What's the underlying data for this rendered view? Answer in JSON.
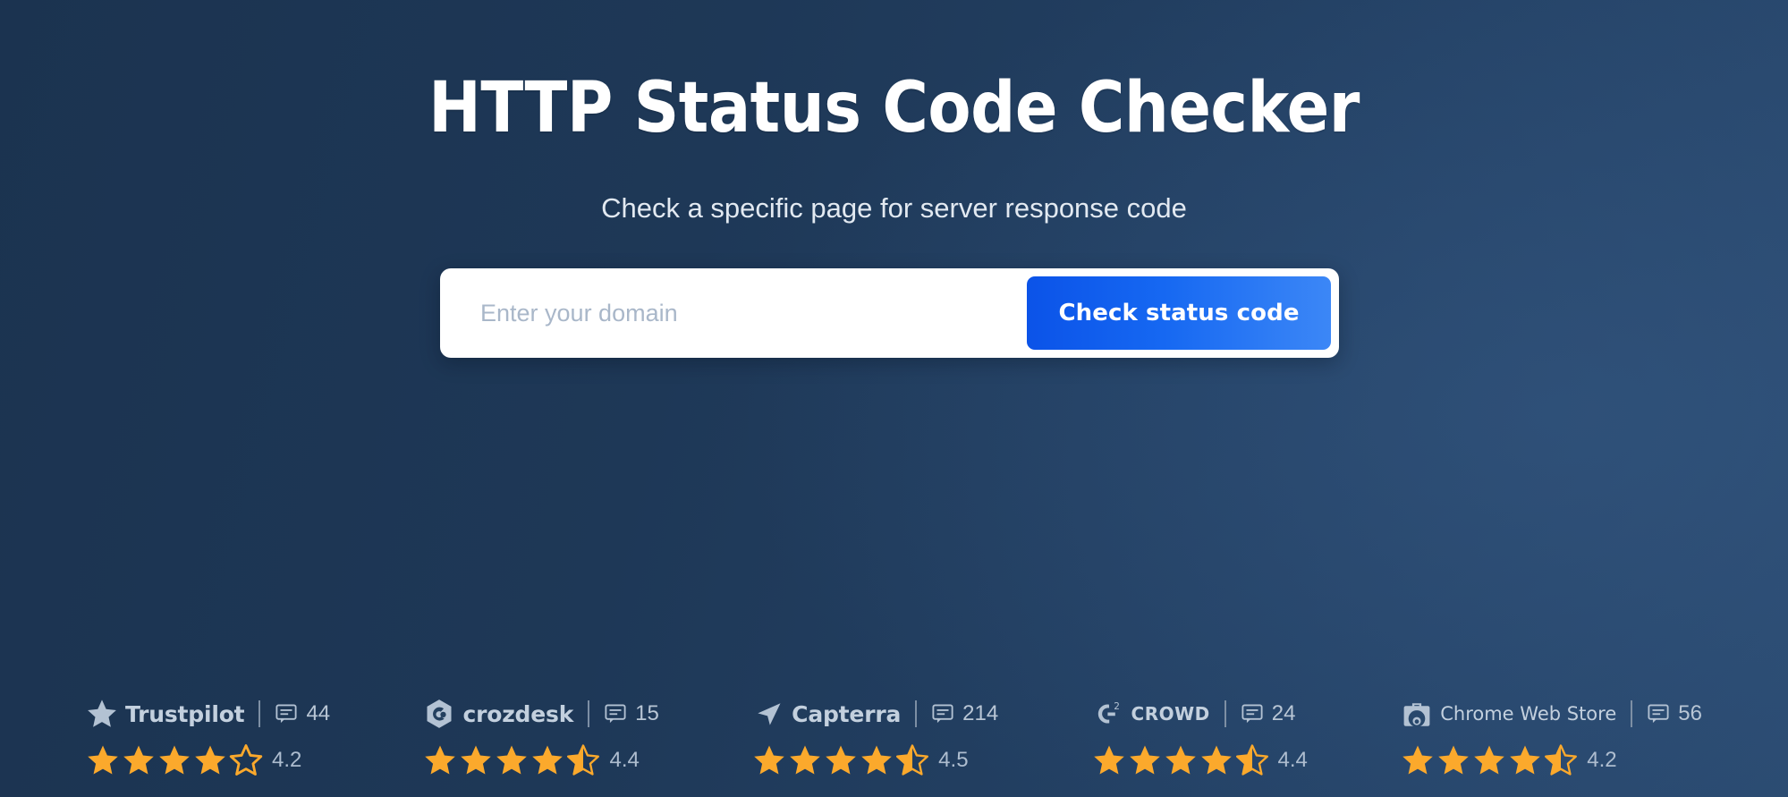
{
  "hero": {
    "title": "HTTP Status Code Checker",
    "subtitle": "Check a specific page for server response code"
  },
  "search": {
    "placeholder": "Enter your domain",
    "value": "",
    "button_label": "Check status code"
  },
  "colors": {
    "background_dark": "#1b3350",
    "background_light": "#2a4a70",
    "button_gradient_start": "#0b53e8",
    "button_gradient_end": "#3c87f6",
    "star_filled": "#fba92c",
    "brand_text": "#c3d0de",
    "card_background": "#ffffff"
  },
  "badges": [
    {
      "brand": "Trustpilot",
      "logo_icon": "trustpilot-star-icon",
      "review_icon": "comment-icon",
      "review_count": "44",
      "rating": "4.2",
      "stars_full": 4,
      "stars_half": 0,
      "stars_empty": 1
    },
    {
      "brand": "crozdesk",
      "logo_icon": "crozdesk-hexagon-icon",
      "review_icon": "comment-icon",
      "review_count": "15",
      "rating": "4.4",
      "stars_full": 4,
      "stars_half": 1,
      "stars_empty": 0
    },
    {
      "brand": "Capterra",
      "logo_icon": "capterra-arrow-icon",
      "review_icon": "comment-icon",
      "review_count": "214",
      "rating": "4.5",
      "stars_full": 4,
      "stars_half": 1,
      "stars_empty": 0
    },
    {
      "brand": "CROWD",
      "logo_icon": "g2-crowd-icon",
      "review_icon": "comment-icon",
      "review_count": "24",
      "rating": "4.4",
      "stars_full": 4,
      "stars_half": 1,
      "stars_empty": 0
    },
    {
      "brand": "Chrome Web Store",
      "logo_icon": "chrome-web-store-bag-icon",
      "review_icon": "comment-icon",
      "review_count": "56",
      "rating": "4.2",
      "stars_full": 4,
      "stars_half": 1,
      "stars_empty": 0
    }
  ]
}
